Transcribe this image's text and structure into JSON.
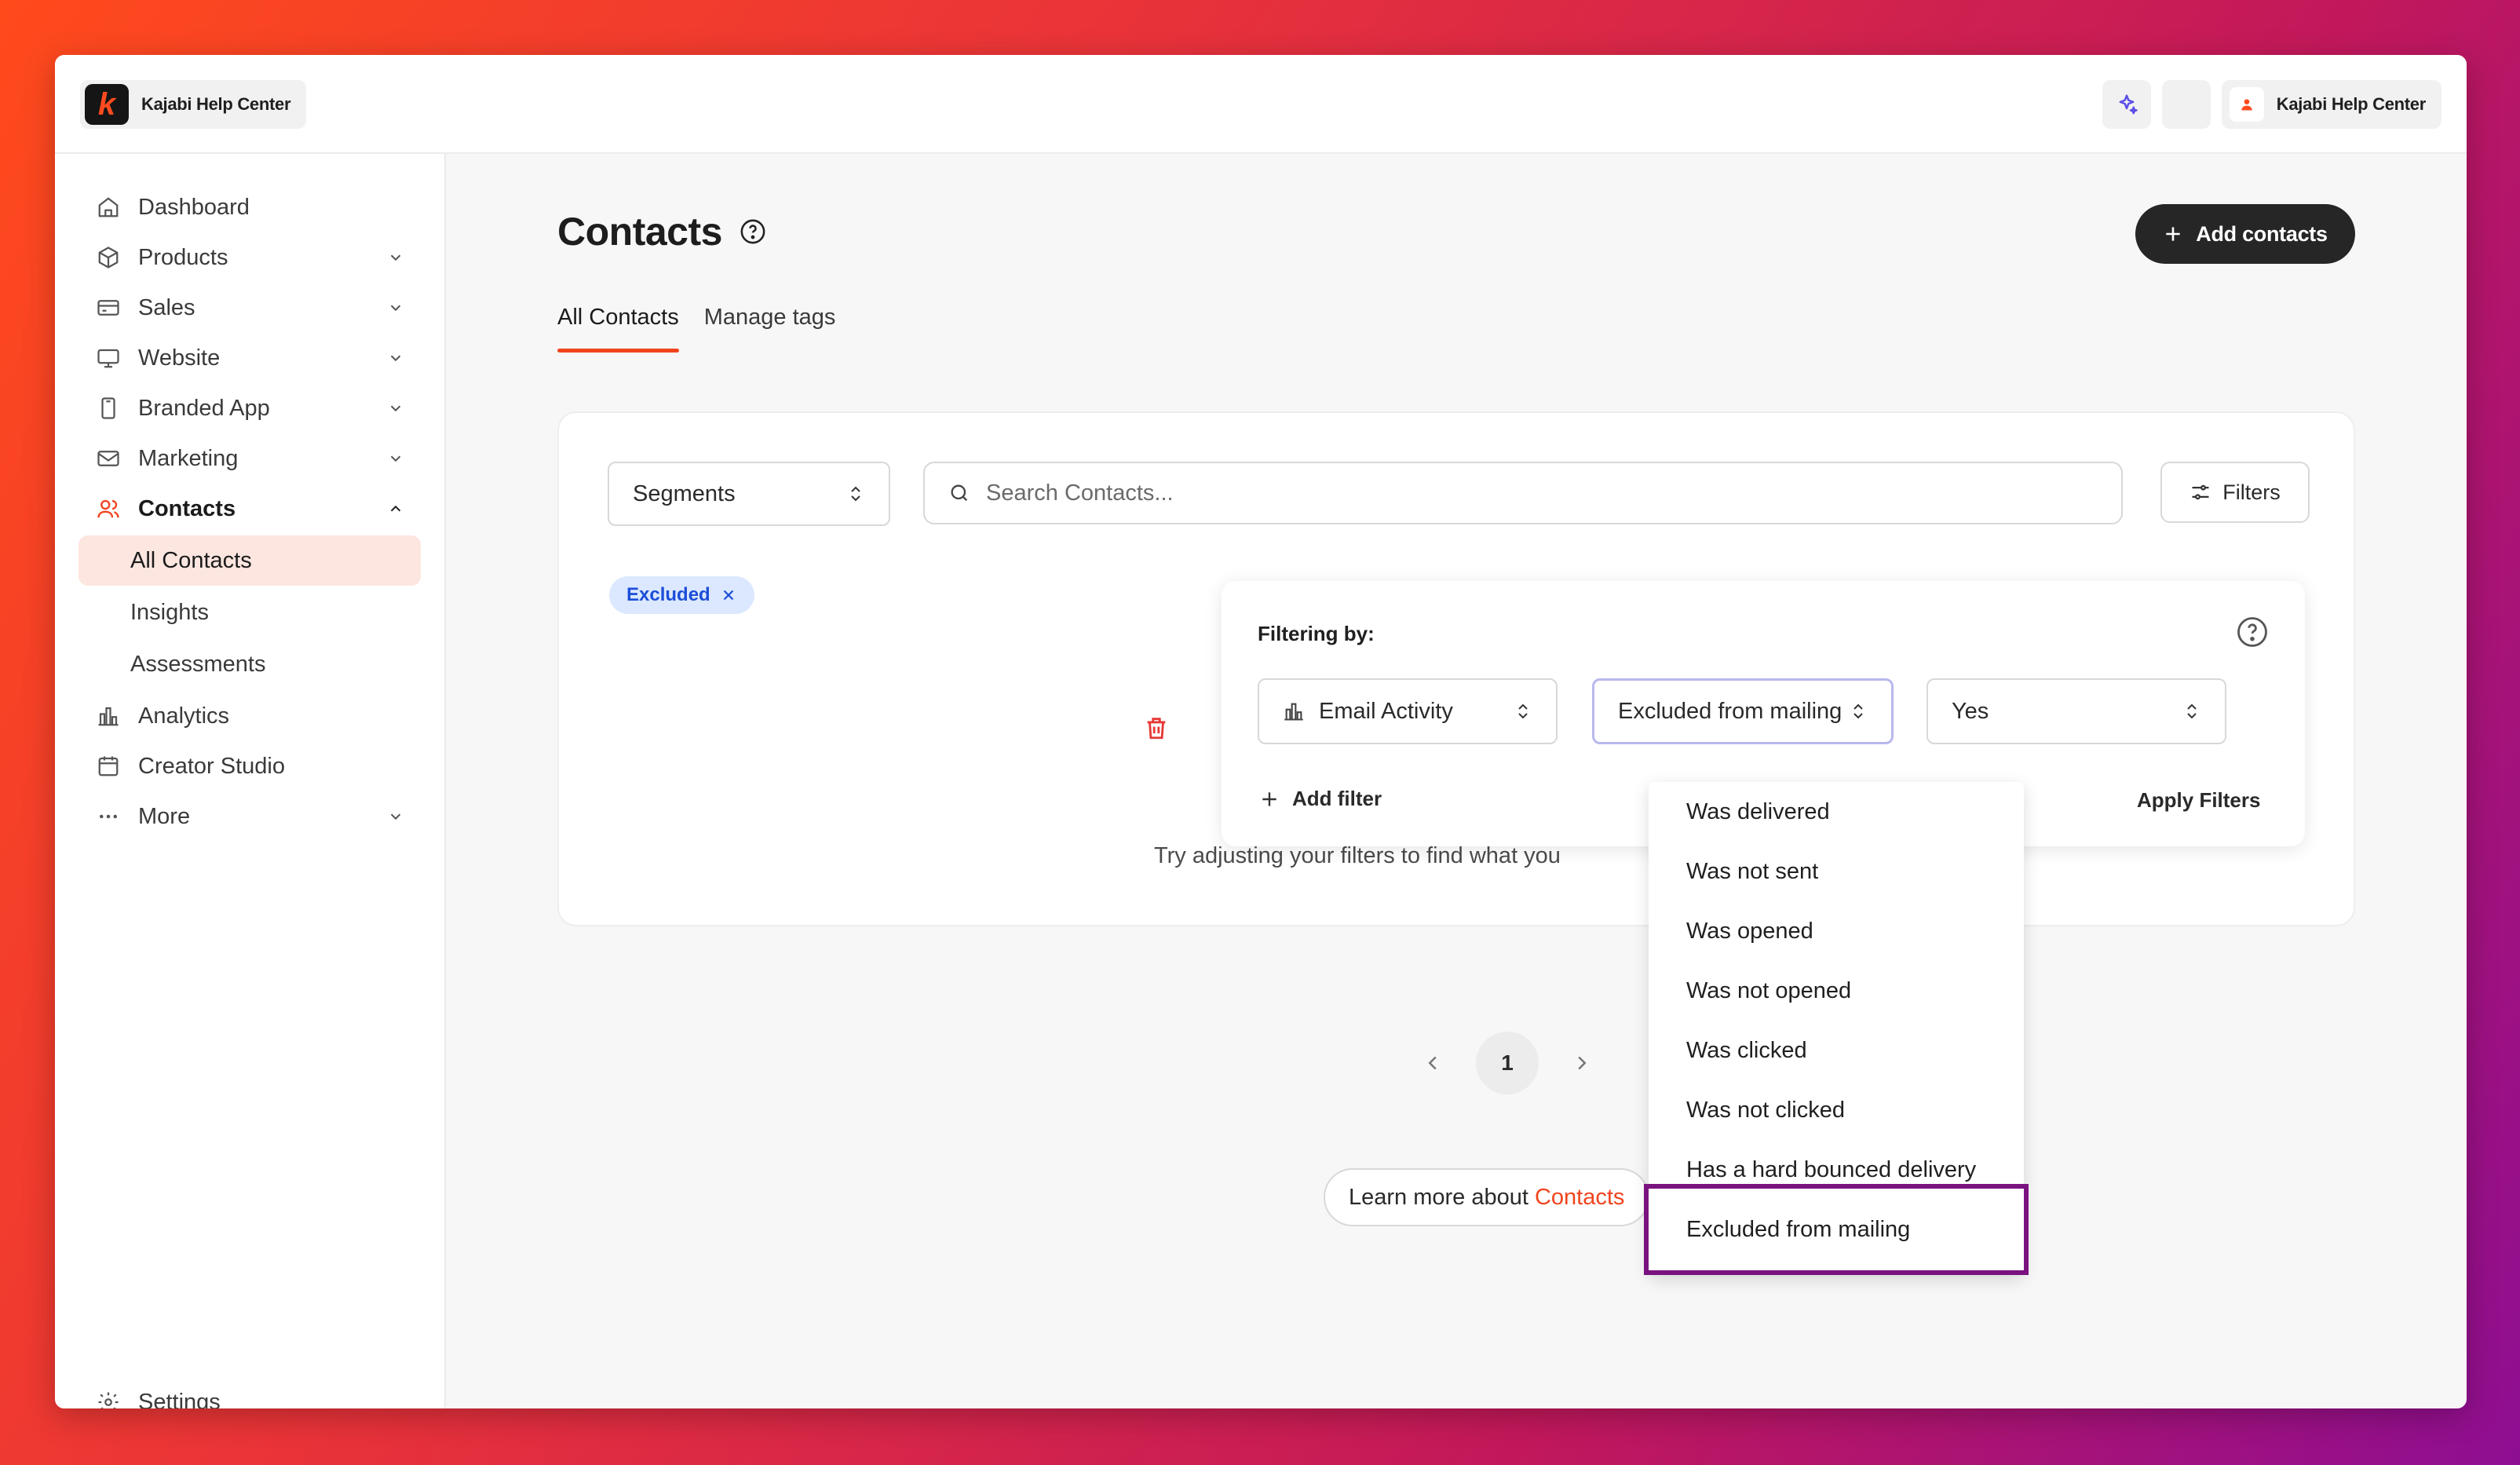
{
  "topbar": {
    "brand_logo_letter": "k",
    "brand_name": "Kajabi Help Center",
    "user_name": "Kajabi Help Center",
    "ai_icon": "sparkle-icon",
    "user_icon": "person-icon"
  },
  "sidebar": {
    "items": [
      {
        "label": "Dashboard",
        "icon": "home-icon"
      },
      {
        "label": "Products",
        "icon": "box-icon"
      },
      {
        "label": "Sales",
        "icon": "card-icon"
      },
      {
        "label": "Website",
        "icon": "monitor-icon"
      },
      {
        "label": "Branded App",
        "icon": "phone-icon"
      },
      {
        "label": "Marketing",
        "icon": "mail-icon"
      },
      {
        "label": "Contacts",
        "icon": "users-icon"
      },
      {
        "label": "Analytics",
        "icon": "chart-icon"
      },
      {
        "label": "Creator Studio",
        "icon": "calendar-icon"
      },
      {
        "label": "More",
        "icon": "dots-icon"
      }
    ],
    "contacts_sub": [
      "All Contacts",
      "Insights",
      "Assessments"
    ],
    "settings_label": "Settings"
  },
  "main": {
    "title": "Contacts",
    "add_contacts_label": "Add contacts",
    "tabs": [
      "All Contacts",
      "Manage tags"
    ],
    "segments_label": "Segments",
    "search_placeholder": "Search Contacts...",
    "filters_label": "Filters",
    "chip_label": "Excluded",
    "empty_text": "Try adjusting your filters to find what you",
    "page_number": "1",
    "learn_more_prefix": "Learn more about",
    "learn_more_link": "Contacts"
  },
  "filter_panel": {
    "title": "Filtering by:",
    "field_select": "Email Activity",
    "condition_select": "Excluded from mailing",
    "value_select": "Yes",
    "add_filter_label": "Add filter",
    "apply_label": "Apply Filters"
  },
  "dropdown": {
    "options": [
      "Was delivered",
      "Was not sent",
      "Was opened",
      "Was not opened",
      "Was clicked",
      "Was not clicked",
      "Has a hard bounced delivery",
      "Excluded from mailing"
    ],
    "highlighted": "Excluded from mailing"
  },
  "colors": {
    "accent": "#f0441e",
    "chip_bg": "#dbe8ff",
    "chip_text": "#1d4ed8",
    "highlight_border": "#7a1280",
    "primary_button": "#262626"
  }
}
